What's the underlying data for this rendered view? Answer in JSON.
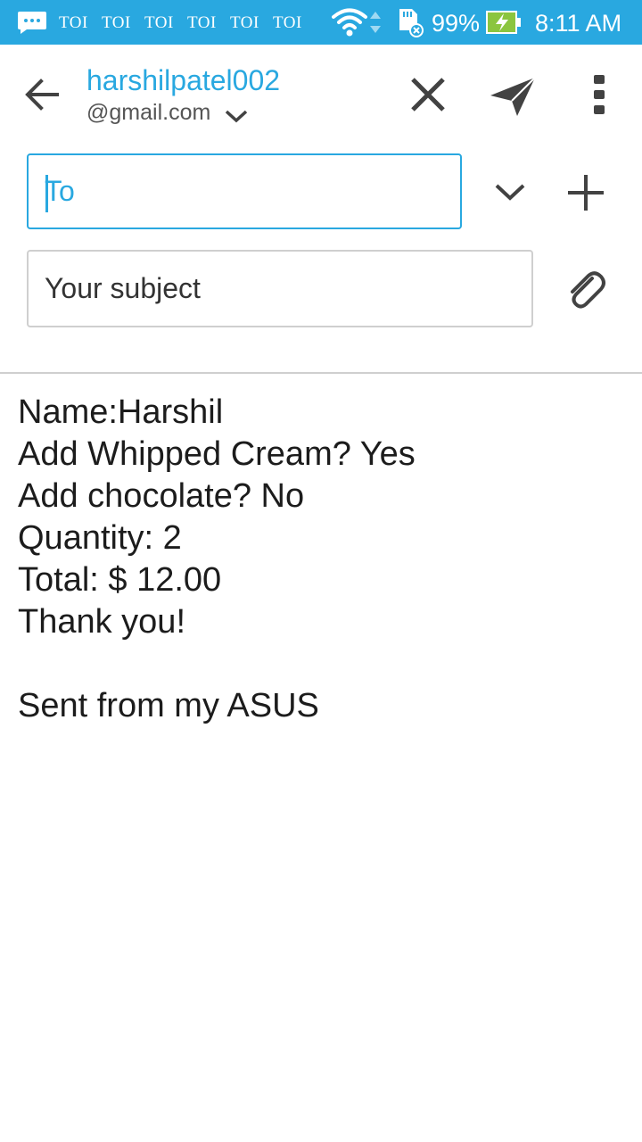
{
  "status_bar": {
    "notifications": [
      "TOI",
      "TOI",
      "TOI",
      "TOI",
      "TOI",
      "TOI"
    ],
    "battery": "99%",
    "time": "8:11 AM",
    "icons": [
      "chat-bubble-icon",
      "wifi-icon",
      "data-arrows-icon",
      "sd-card-icon",
      "battery-charging-icon"
    ]
  },
  "header": {
    "account_name": "harshilpatel002",
    "account_domain": "@gmail.com",
    "icons": [
      "back-arrow-icon",
      "chevron-down-icon",
      "close-icon",
      "send-icon",
      "more-vert-icon"
    ]
  },
  "compose": {
    "to_placeholder": "To",
    "to_value": "",
    "subject_placeholder": "Your subject",
    "subject_value": "",
    "icons": [
      "expand-recipients-icon",
      "add-recipient-icon",
      "attach-icon"
    ]
  },
  "body": {
    "lines": [
      "Name:Harshil",
      "Add Whipped Cream? Yes",
      "Add chocolate? No",
      "Quantity: 2",
      "Total: $ 12.00",
      "Thank you!",
      "",
      "Sent from my ASUS"
    ]
  },
  "colors": {
    "accent": "#29a8e0",
    "icon": "#424242",
    "divider": "#cfcfcf"
  }
}
